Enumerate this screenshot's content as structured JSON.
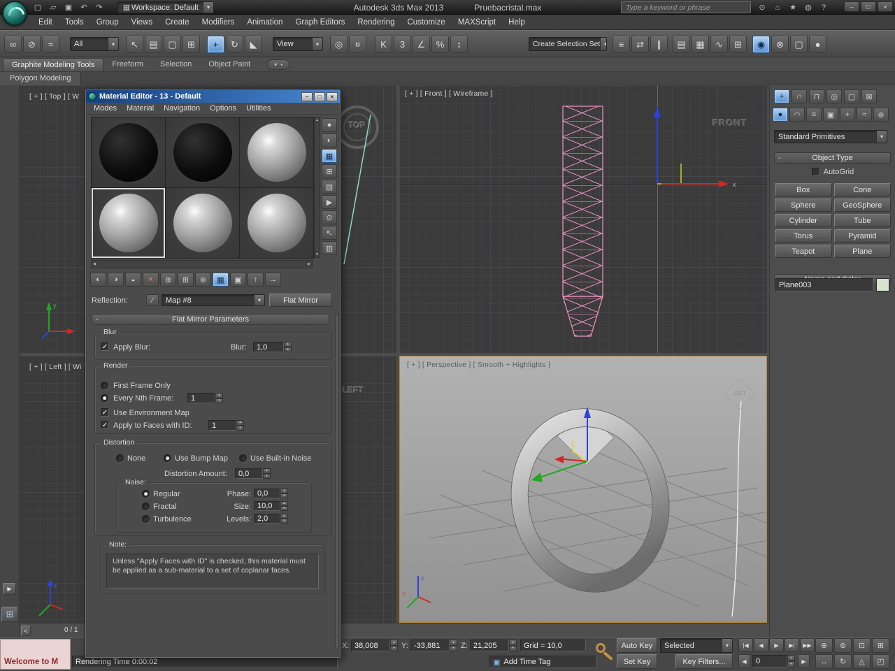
{
  "ui": {
    "dropdown_arrow": "▾",
    "spinner_up": "▴",
    "spinner_down": "▾",
    "minus": "-"
  },
  "titlebar": {
    "quick_icons": [
      {
        "name": "new-scene-icon",
        "glyph": "▢"
      },
      {
        "name": "open-file-icon",
        "glyph": "▱"
      },
      {
        "name": "save-file-icon",
        "glyph": "▣"
      },
      {
        "name": "undo-icon",
        "glyph": "↶"
      },
      {
        "name": "redo-icon",
        "glyph": "↷"
      }
    ],
    "workspace_icon": "▦",
    "workspace": "Workspace: Default",
    "app_title": "Autodesk 3ds Max  2013",
    "doc_name": "Pruebacristal.max",
    "search_placeholder": "Type a keyword or phrase",
    "right_icons": [
      {
        "name": "search-icon",
        "glyph": "⊙"
      },
      {
        "name": "community-icon",
        "glyph": "⌂"
      },
      {
        "name": "favorites-icon",
        "glyph": "★"
      },
      {
        "name": "notifications-icon",
        "glyph": "◍"
      },
      {
        "name": "help-icon",
        "glyph": "?"
      }
    ],
    "window_buttons": [
      {
        "name": "minimize-button",
        "glyph": "–"
      },
      {
        "name": "restore-button",
        "glyph": "□"
      },
      {
        "name": "close-button",
        "glyph": "×"
      }
    ]
  },
  "menubar": {
    "items": [
      {
        "label": "Edit",
        "name": "menu-edit"
      },
      {
        "label": "Tools",
        "name": "menu-tools"
      },
      {
        "label": "Group",
        "name": "menu-group"
      },
      {
        "label": "Views",
        "name": "menu-views"
      },
      {
        "label": "Create",
        "name": "menu-create"
      },
      {
        "label": "Modifiers",
        "name": "menu-modifiers"
      },
      {
        "label": "Animation",
        "name": "menu-animation"
      },
      {
        "label": "Graph Editors",
        "name": "menu-graph-editors"
      },
      {
        "label": "Rendering",
        "name": "menu-rendering"
      },
      {
        "label": "Customize",
        "name": "menu-customize"
      },
      {
        "label": "MAXScript",
        "name": "menu-maxscript"
      },
      {
        "label": "Help",
        "name": "menu-help"
      }
    ]
  },
  "toolbar": {
    "filter": "All",
    "view": "View",
    "selection_set": "Create Selection Set",
    "group1": [
      {
        "name": "select-and-link-icon",
        "glyph": "∞"
      },
      {
        "name": "unlink-selection-icon",
        "glyph": "⊘"
      },
      {
        "name": "bind-to-space-warp-icon",
        "glyph": "≈"
      }
    ],
    "group2": [
      {
        "name": "select-object-icon",
        "glyph": "↖"
      },
      {
        "name": "select-by-name-icon",
        "glyph": "▤"
      },
      {
        "name": "rectangular-region-icon",
        "glyph": "▢"
      },
      {
        "name": "window-crossing-icon",
        "glyph": "⊞"
      }
    ],
    "group3": [
      {
        "name": "select-and-move-icon",
        "glyph": "+",
        "active": true
      },
      {
        "name": "select-and-rotate-icon",
        "glyph": "↻"
      },
      {
        "name": "select-and-scale-icon",
        "glyph": "◣"
      }
    ],
    "group4": [
      {
        "name": "reference-coordinate-icon",
        "glyph": "◎"
      },
      {
        "name": "select-and-manipulate-icon",
        "glyph": "¤"
      }
    ],
    "group5": [
      {
        "name": "keyboard-override-icon",
        "glyph": "K"
      },
      {
        "name": "snap-toggle-3d-icon",
        "glyph": "3"
      },
      {
        "name": "angle-snap-icon",
        "glyph": "∠"
      },
      {
        "name": "percent-snap-icon",
        "glyph": "%"
      },
      {
        "name": "spinner-snap-icon",
        "glyph": "↕"
      }
    ],
    "group6": [
      {
        "name": "edit-named-sets-icon",
        "glyph": "≡"
      },
      {
        "name": "mirror-icon",
        "glyph": "⇄"
      },
      {
        "name": "align-icon",
        "glyph": "∥"
      }
    ],
    "group7": [
      {
        "name": "layer-manager-icon",
        "glyph": "▤"
      },
      {
        "name": "ribbon-toggle-icon",
        "glyph": "▦"
      },
      {
        "name": "curve-editor-icon",
        "glyph": "∿"
      },
      {
        "name": "schematic-view-icon",
        "glyph": "⊞"
      }
    ],
    "group8": [
      {
        "name": "material-editor-icon",
        "glyph": "◉",
        "active": true
      },
      {
        "name": "render-setup-icon",
        "glyph": "⊗"
      },
      {
        "name": "rendered-frame-icon",
        "glyph": "▢"
      },
      {
        "name": "render-production-icon",
        "glyph": "●"
      }
    ]
  },
  "ribbon": {
    "tabs": [
      {
        "label": "Graphite Modeling Tools",
        "name": "tab-graphite-modeling-tools",
        "active": true
      },
      {
        "label": "Freeform",
        "name": "tab-freeform"
      },
      {
        "label": "Selection",
        "name": "tab-selection"
      },
      {
        "label": "Object Paint",
        "name": "tab-object-paint"
      }
    ],
    "collapse_glyph": "▾",
    "pill_glyph": "▪",
    "subtab": "Polygon Modeling"
  },
  "material_editor": {
    "title": "Material Editor - 13 - Default",
    "menus": [
      {
        "label": "Modes",
        "name": "me-menu-modes"
      },
      {
        "label": "Material",
        "name": "me-menu-material"
      },
      {
        "label": "Navigation",
        "name": "me-menu-navigation"
      },
      {
        "label": "Options",
        "name": "me-menu-options"
      },
      {
        "label": "Utilities",
        "name": "me-menu-utilities"
      }
    ],
    "window_buttons": [
      {
        "name": "me-minimize-button",
        "glyph": "–"
      },
      {
        "name": "me-maximize-button",
        "glyph": "□"
      },
      {
        "name": "me-close-button",
        "glyph": "×"
      }
    ],
    "slots": [
      {
        "name": "material-slot-1",
        "cls": "black"
      },
      {
        "name": "material-slot-2",
        "cls": "black"
      },
      {
        "name": "material-slot-3",
        "cls": "gray"
      },
      {
        "name": "material-slot-4",
        "cls": "gray",
        "active": true
      },
      {
        "name": "material-slot-5",
        "cls": "gray"
      },
      {
        "name": "material-slot-6",
        "cls": "gray"
      }
    ],
    "scroll_up": "▲",
    "scroll_down": "▼",
    "scroll_left": "◀",
    "scroll_right": "▶",
    "side_tools": [
      {
        "name": "sample-type-icon",
        "glyph": "●"
      },
      {
        "name": "backlight-icon",
        "glyph": "◐"
      },
      {
        "name": "background-icon",
        "glyph": "▦",
        "active": true
      },
      {
        "name": "sample-uv-tiling-icon",
        "glyph": "⊞"
      },
      {
        "name": "video-color-check-icon",
        "glyph": "▤"
      },
      {
        "name": "make-preview-icon",
        "glyph": "▶"
      },
      {
        "name": "material-options-icon",
        "glyph": "⊙"
      },
      {
        "name": "select-by-material-icon",
        "glyph": "↖"
      },
      {
        "name": "material-map-navigator-icon",
        "glyph": "▥"
      }
    ],
    "toolbar_icons": [
      {
        "name": "get-material-icon",
        "glyph": "◐"
      },
      {
        "name": "put-material-to-scene-icon",
        "glyph": "◑"
      },
      {
        "name": "assign-material-icon",
        "glyph": "◒"
      },
      {
        "name": "reset-map-icon",
        "glyph": "×",
        "cls": "red"
      },
      {
        "name": "make-unique-icon",
        "glyph": "⊕"
      },
      {
        "name": "put-to-library-icon",
        "glyph": "⊞"
      },
      {
        "name": "material-id-channel-icon",
        "glyph": "⊚"
      },
      {
        "name": "show-map-in-viewport-icon",
        "glyph": "▦",
        "active": true
      },
      {
        "name": "show-end-result-icon",
        "glyph": "▣"
      },
      {
        "name": "go-to-parent-icon",
        "glyph": "↑"
      },
      {
        "name": "go-forward-sibling-icon",
        "glyph": "→"
      }
    ],
    "reflection_label": "Reflection:",
    "map_name": "Map #8",
    "type_button": "Flat Mirror",
    "rollout": "Flat Mirror Parameters",
    "groups": {
      "blur": {
        "legend": "Blur",
        "apply_blur": "Apply Blur:",
        "apply_blur_checked": true,
        "blur_label": "Blur:",
        "blur_value": "1,0"
      },
      "render": {
        "legend": "Render",
        "first_frame": "First Frame Only",
        "first_frame_on": false,
        "every_nth": "Every Nth Frame:",
        "every_nth_on": true,
        "every_nth_value": "1",
        "use_env": "Use Environment Map",
        "use_env_checked": true,
        "apply_faces": "Apply to Faces with ID:",
        "apply_faces_checked": true,
        "apply_faces_value": "1"
      },
      "distortion": {
        "legend": "Distortion",
        "none": "None",
        "none_on": false,
        "use_bump": "Use Bump Map",
        "use_bump_on": true,
        "use_builtin": "Use Built-in Noise",
        "use_builtin_on": false,
        "amount_label": "Distortion Amount:",
        "amount_value": "0,0"
      },
      "noise": {
        "legend": "Noise:",
        "regular": "Regular",
        "regular_on": true,
        "fractal": "Fractal",
        "fractal_on": false,
        "turbulence": "Turbulence",
        "turbulence_on": false,
        "phase_label": "Phase:",
        "phase": "0,0",
        "size_label": "Size:",
        "size": "10,0",
        "levels_label": "Levels:",
        "levels": "2,0"
      },
      "note": {
        "legend": "Note:",
        "text": "Unless \"Apply Faces with ID\" is checked, this material must be applied as a sub-material to a set of coplanar faces."
      }
    }
  },
  "viewports": {
    "top_label": "[ + ] [ Top ] [ W",
    "left_label": "[ + ] [ Left ] [ Wi",
    "front_label": "[ + ] [ Front ] [ Wireframe ]",
    "persp_label": "[ + ] [ Perspective ] [ Smooth + Highlights ]",
    "front_cube": "FRONT",
    "top_cube": "TOP",
    "left_cube": "LEFT",
    "persp_cube": "LEFT",
    "axis": {
      "x": "x",
      "y": "y",
      "z": "z"
    },
    "wireframe_color": "#f095c5",
    "active_border_color": "#b5873a"
  },
  "command_panel": {
    "tabs": [
      {
        "name": "create-tab-icon",
        "glyph": "+",
        "active": true
      },
      {
        "name": "modify-tab-icon",
        "glyph": "∩"
      },
      {
        "name": "hierarchy-tab-icon",
        "glyph": "⊓"
      },
      {
        "name": "motion-tab-icon",
        "glyph": "◎"
      },
      {
        "name": "display-tab-icon",
        "glyph": "▢"
      },
      {
        "name": "utilities-tab-icon",
        "glyph": "⊠"
      }
    ],
    "categories": [
      {
        "name": "geometry-icon",
        "glyph": "●",
        "active": true
      },
      {
        "name": "shapes-icon",
        "glyph": "◠"
      },
      {
        "name": "lights-icon",
        "glyph": "¤"
      },
      {
        "name": "cameras-icon",
        "glyph": "▣"
      },
      {
        "name": "helpers-icon",
        "glyph": "+"
      },
      {
        "name": "space-warps-icon",
        "glyph": "≈"
      },
      {
        "name": "systems-icon",
        "glyph": "⊛"
      }
    ],
    "dropdown": "Standard Primitives",
    "object_type_rollout": "Object Type",
    "autogrid": "AutoGrid",
    "autogrid_checked": false,
    "buttons": [
      {
        "label": "Box",
        "name": "box-button"
      },
      {
        "label": "Cone",
        "name": "cone-button"
      },
      {
        "label": "Sphere",
        "name": "sphere-button"
      },
      {
        "label": "GeoSphere",
        "name": "geosphere-button"
      },
      {
        "label": "Cylinder",
        "name": "cylinder-button"
      },
      {
        "label": "Tube",
        "name": "tube-button"
      },
      {
        "label": "Torus",
        "name": "torus-button"
      },
      {
        "label": "Pyramid",
        "name": "pyramid-button"
      },
      {
        "label": "Teapot",
        "name": "teapot-button"
      },
      {
        "label": "Plane",
        "name": "plane-button"
      }
    ],
    "name_color_rollout": "Name and Color",
    "object_name": "Plane003",
    "swatch_color": "#d7e3cf"
  },
  "left_strip": {
    "expand_glyph": "▶",
    "layout_glyph": "⊞"
  },
  "track": {
    "arrow": "<",
    "text": "0 / 1"
  },
  "statusbar": {
    "welcome_title": "Welcome to M",
    "rendering_time": "Rendering Time 0:00:02",
    "x_label": "X:",
    "x_value": "38,008",
    "y_label": "Y:",
    "y_value": "-33,881",
    "z_label": "Z:",
    "z_value": "21,205",
    "grid_label": "Grid = 10,0",
    "add_time_tag": "Add Time Tag",
    "time_tag_glyph": "▣",
    "auto_key": "Auto Key",
    "set_key": "Set Key",
    "selected_value": "Selected",
    "key_filters": "Key Filters...",
    "frame_value": "0",
    "prev_key_glyph": "◀",
    "next_key_glyph": "▶",
    "playback": [
      {
        "name": "go-to-start-button",
        "glyph": "|◀"
      },
      {
        "name": "previous-frame-button",
        "glyph": "◀"
      },
      {
        "name": "play-button",
        "glyph": "▶"
      },
      {
        "name": "next-frame-button",
        "glyph": "▶|"
      },
      {
        "name": "go-to-end-button",
        "glyph": "▶▶"
      }
    ],
    "nav_icons": [
      {
        "name": "zoom-icon",
        "glyph": "⊕"
      },
      {
        "name": "zoom-all-icon",
        "glyph": "⊛"
      },
      {
        "name": "zoom-extents-icon",
        "glyph": "⊡"
      },
      {
        "name": "zoom-region-icon",
        "glyph": "⊞"
      },
      {
        "name": "pan-icon",
        "glyph": "↔"
      },
      {
        "name": "orbit-icon",
        "glyph": "↻"
      },
      {
        "name": "fov-icon",
        "glyph": "◬"
      },
      {
        "name": "maximize-viewport-icon",
        "glyph": "◰"
      }
    ]
  }
}
